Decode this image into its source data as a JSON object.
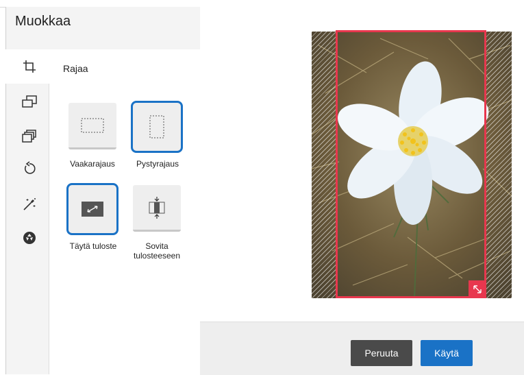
{
  "panel": {
    "title": "Muokkaa",
    "active_tab_label": "Rajaa",
    "rail_icons": [
      "crop-icon",
      "layout-icon",
      "layers-icon",
      "rotate-icon",
      "magic-wand-icon",
      "aperture-icon"
    ]
  },
  "crop_options": [
    {
      "label": "Vaakarajaus",
      "selected": false
    },
    {
      "label": "Pystyrajaus",
      "selected": true
    },
    {
      "label": "Täytä tuloste",
      "selected": true
    },
    {
      "label": "Sovita tulosteeseen",
      "label_line1": "Sovita",
      "label_line2": "tulosteeseen",
      "selected": false
    }
  ],
  "buttons": {
    "cancel": "Peruuta",
    "apply": "Käytä"
  },
  "colors": {
    "accent": "#1a72c6",
    "crop_frame": "#e8374e",
    "cancel_button": "#4a4a4a"
  }
}
